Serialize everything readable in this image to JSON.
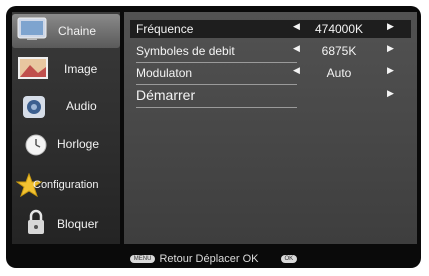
{
  "sidebar": {
    "items": [
      {
        "label": "Chaine",
        "icon": "tv-icon"
      },
      {
        "label": "Image",
        "icon": "picture-icon"
      },
      {
        "label": "Audio",
        "icon": "speaker-icon"
      },
      {
        "label": "Horloge",
        "icon": "clock-icon"
      },
      {
        "label": "Configuration",
        "icon": "star-tools-icon"
      },
      {
        "label": "Bloquer",
        "icon": "lock-icon"
      }
    ]
  },
  "settings": {
    "frequence": {
      "label": "Fréquence",
      "value": "474000K"
    },
    "symboles": {
      "label": "Symboles de debit",
      "value": "6875K"
    },
    "modulation": {
      "label": "Modulaton",
      "value": "Auto"
    },
    "demarrer": {
      "label": "Démarrer"
    }
  },
  "footer": {
    "menu_key": "MENU",
    "text": "Retour Déplacer OK",
    "ok_key": "OK"
  },
  "colors": {
    "active_bg": "#7a7a7a",
    "panel_bg": "#4a4a4a",
    "sidebar_bg": "#2e2e2e",
    "selected_row": "#1e1e1e"
  }
}
